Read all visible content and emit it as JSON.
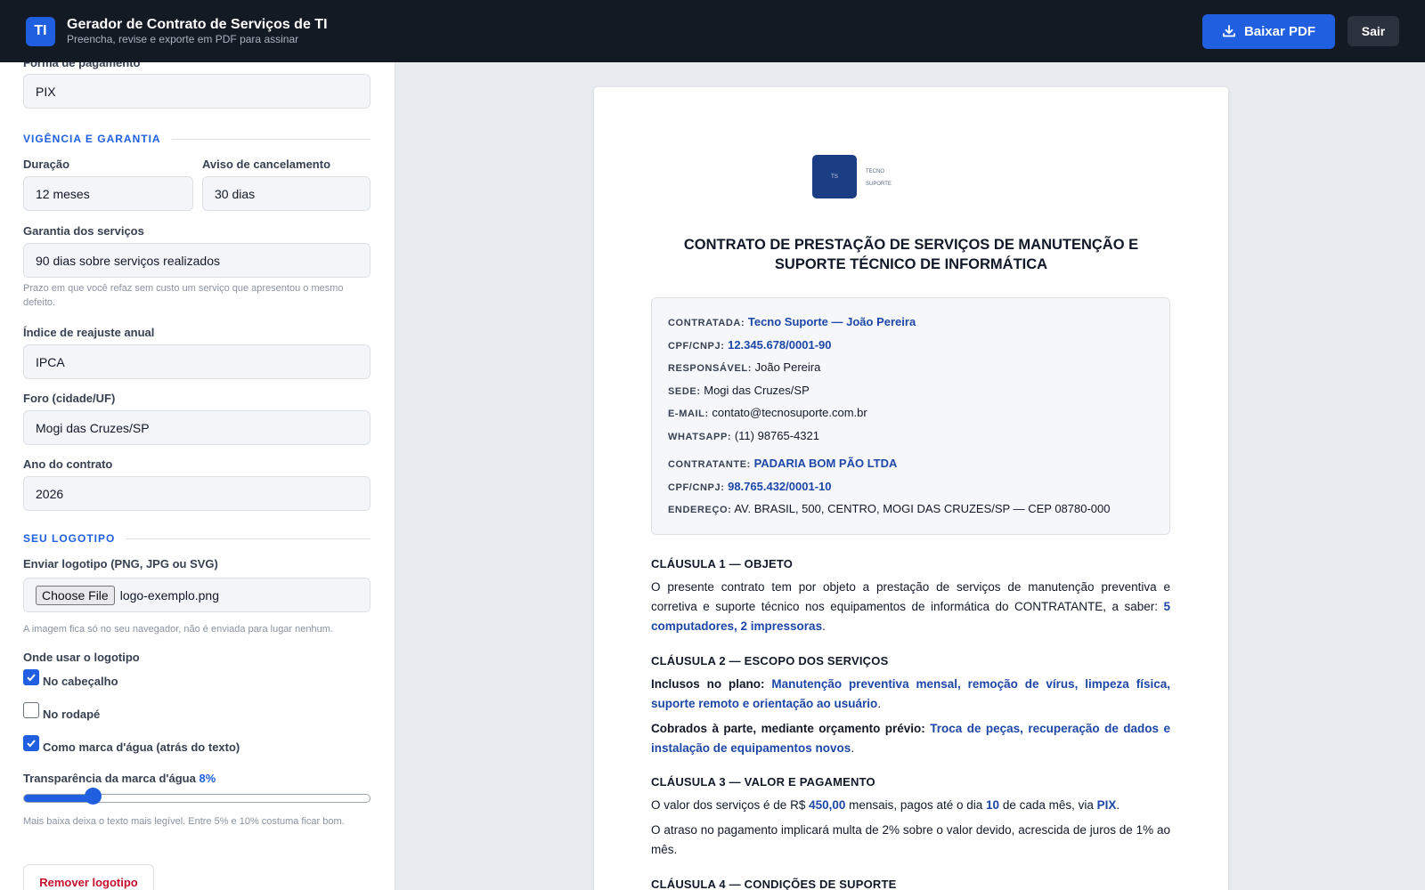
{
  "header": {
    "logo_text": "TI",
    "title": "Gerador de Contrato de Serviços de TI",
    "subtitle": "Preencha, revise e exporte em PDF para assinar",
    "download_label": "Baixar PDF",
    "download_icon": "download-icon",
    "exit_label": "Sair",
    "brand_color": "#1f5fe0"
  },
  "form": {
    "payment_label": "Forma de pagamento",
    "payment_value": "PIX",
    "section_validity": "VIGÊNCIA E GARANTIA",
    "duration_label": "Duração",
    "duration_value": "12 meses",
    "notice_label": "Aviso de cancelamento",
    "notice_value": "30 dias",
    "warranty_label": "Garantia dos serviços",
    "warranty_value": "90 dias sobre serviços realizados",
    "warranty_hint": "Prazo em que você refaz sem custo um serviço que apresentou o mesmo defeito.",
    "index_label": "Índice de reajuste anual",
    "index_value": "IPCA",
    "forum_label": "Foro (cidade/UF)",
    "forum_value": "Mogi das Cruzes/SP",
    "year_label": "Ano do contrato",
    "year_value": "2026",
    "section_logo": "SEU LOGOTIPO",
    "upload_label": "Enviar logotipo (PNG, JPG ou SVG)",
    "choose_file": "Choose File",
    "file_name": "logo-exemplo.png",
    "upload_hint": "A imagem fica só no seu navegador, não é enviada para lugar nenhum.",
    "where_label": "Onde usar o logotipo",
    "opt_header": "No cabeçalho",
    "opt_header_checked": true,
    "opt_footer": "No rodapé",
    "opt_footer_checked": false,
    "opt_watermark": "Como marca d'água (atrás do texto)",
    "opt_watermark_checked": true,
    "transparency_label": "Transparência da marca d'água",
    "transparency_value": "8%",
    "transparency_level": 0.2,
    "transparency_hint": "Mais baixa deixa o texto mais legível. Entre 5% e 10% costuma ficar bom.",
    "remove_label": "Remover logotipo"
  },
  "doc": {
    "logo_initials": "TS",
    "logo_line1": "TECNO",
    "logo_line2": "SUPORTE",
    "title": "CONTRATO DE PRESTAÇÃO DE SERVIÇOS DE MANUTENÇÃO E SUPORTE TÉCNICO DE INFORMÁTICA",
    "contratada_k": "CONTRATADA:",
    "contratada_v": "Tecno Suporte — João Pereira",
    "cnpj1_k": "CPF/CNPJ:",
    "cnpj1_v": "12.345.678/0001-90",
    "resp_k": "RESPONSÁVEL:",
    "resp_v": "João Pereira",
    "sede_k": "SEDE:",
    "sede_v": "Mogi das Cruzes/SP",
    "email_k": "E-MAIL:",
    "email_v": "contato@tecnosuporte.com.br",
    "whats_k": "WHATSAPP:",
    "whats_v": "(11) 98765-4321",
    "contratante_k": "CONTRATANTE:",
    "contratante_v": "PADARIA BOM PÃO LTDA",
    "cnpj2_k": "CPF/CNPJ:",
    "cnpj2_v": "98.765.432/0001-10",
    "end_k": "ENDEREÇO:",
    "end_v": "AV. BRASIL, 500, CENTRO, MOGI DAS CRUZES/SP — CEP 08780-000",
    "c1_title": "CLÁUSULA 1 — OBJETO",
    "c1_text": "O presente contrato tem por objeto a prestação de serviços de manutenção preventiva e corretiva e suporte técnico nos equipamentos de informática do CONTRATANTE, a saber:",
    "c1_hl": "5 computadores, 2 impressoras",
    "c2_title": "CLÁUSULA 2 — ESCOPO DOS SERVIÇOS",
    "c2_inc_k": "Inclusos no plano:",
    "c2_inc_v": "Manutenção preventiva mensal, remoção de vírus, limpeza física, suporte remoto e orientação ao usuário",
    "c2_exc_k": "Cobrados à parte, mediante orçamento prévio:",
    "c2_exc_v": "Troca de peças, recuperação de dados e instalação de equipamentos novos",
    "c3_title": "CLÁUSULA 3 — VALOR E PAGAMENTO",
    "c3_a": "O valor dos serviços é de R$",
    "c3_value": "450,00",
    "c3_b": "mensais, pagos até o dia",
    "c3_day": "10",
    "c3_c": "de cada mês, via",
    "c3_method": "PIX",
    "c3_late": "O atraso no pagamento implicará multa de 2% sobre o valor devido, acrescida de juros de 1% ao mês.",
    "c4_title": "CLÁUSULA 4 — CONDIÇÕES DE SUPORTE"
  }
}
